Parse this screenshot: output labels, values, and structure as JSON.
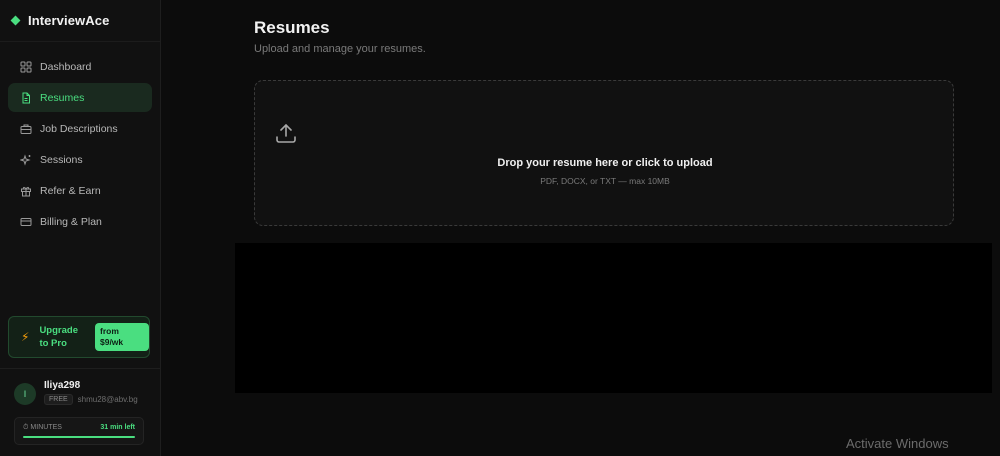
{
  "brand": {
    "name": "InterviewAce"
  },
  "sidebar": {
    "items": [
      {
        "label": "Dashboard",
        "icon": "grid-icon",
        "active": false
      },
      {
        "label": "Resumes",
        "icon": "file-icon",
        "active": true
      },
      {
        "label": "Job Descriptions",
        "icon": "briefcase-icon",
        "active": false
      },
      {
        "label": "Sessions",
        "icon": "sparkles-icon",
        "active": false
      },
      {
        "label": "Refer & Earn",
        "icon": "gift-icon",
        "active": false
      },
      {
        "label": "Billing & Plan",
        "icon": "credit-card-icon",
        "active": false
      }
    ],
    "upgrade": {
      "label": "Upgrade to Pro",
      "price": "from $9/wk"
    }
  },
  "user": {
    "initial": "I",
    "name": "Iliya298",
    "plan": "FREE",
    "email": "shmu28@abv.bg",
    "minutes_label": "MINUTES",
    "minutes_left": "31 min left",
    "minutes_fraction": 1.0
  },
  "main": {
    "title": "Resumes",
    "subtitle": "Upload and manage your resumes.",
    "dropzone": {
      "title": "Drop your resume here or click to upload",
      "subtitle": "PDF, DOCX, or TXT — max 10MB"
    }
  },
  "watermark": "Activate Windows",
  "colors": {
    "accent": "#4ade80",
    "background": "#0c0c0c",
    "sidebar": "#111111"
  }
}
